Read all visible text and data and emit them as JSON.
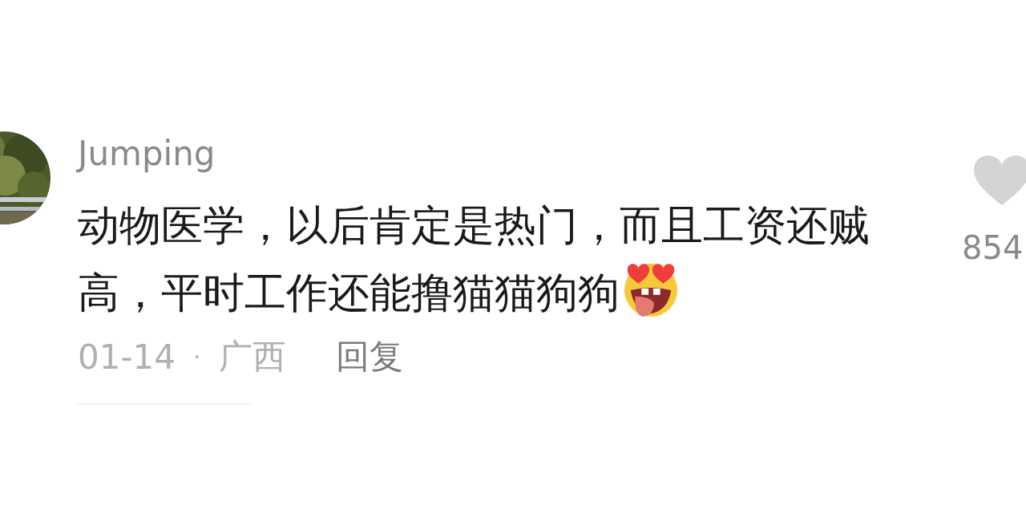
{
  "comment": {
    "author": "Jumping",
    "text": "动物医学，以后肯定是热门，而且工资还贼高，平时工作还能撸猫猫狗狗",
    "date": "01-14",
    "separator": "·",
    "location": "广西",
    "reply": "回复",
    "liked": false,
    "likes": "854"
  }
}
